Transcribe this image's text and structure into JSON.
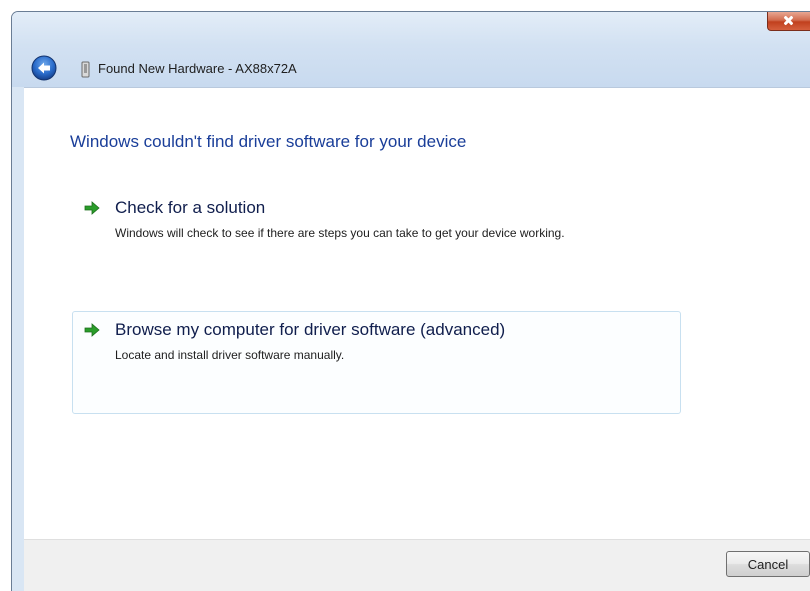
{
  "window": {
    "title": "Found New Hardware - AX88x72A"
  },
  "main": {
    "heading": "Windows couldn't find driver software for your device",
    "options": [
      {
        "title": "Check for a solution",
        "description": "Windows will check to see if there are steps you can take to get your device working."
      },
      {
        "title": "Browse my computer for driver software (advanced)",
        "description": "Locate and install driver software manually."
      }
    ]
  },
  "footer": {
    "cancel_label": "Cancel"
  },
  "icons": {
    "back": "back-arrow-icon",
    "device": "hardware-device-icon",
    "option_arrow": "green-arrow-icon",
    "close": "close-icon"
  },
  "colors": {
    "heading": "#1a3e99",
    "option_arrow": "#2a9d2a",
    "back_button": "#1e5fbf",
    "close_button": "#c1401e"
  }
}
